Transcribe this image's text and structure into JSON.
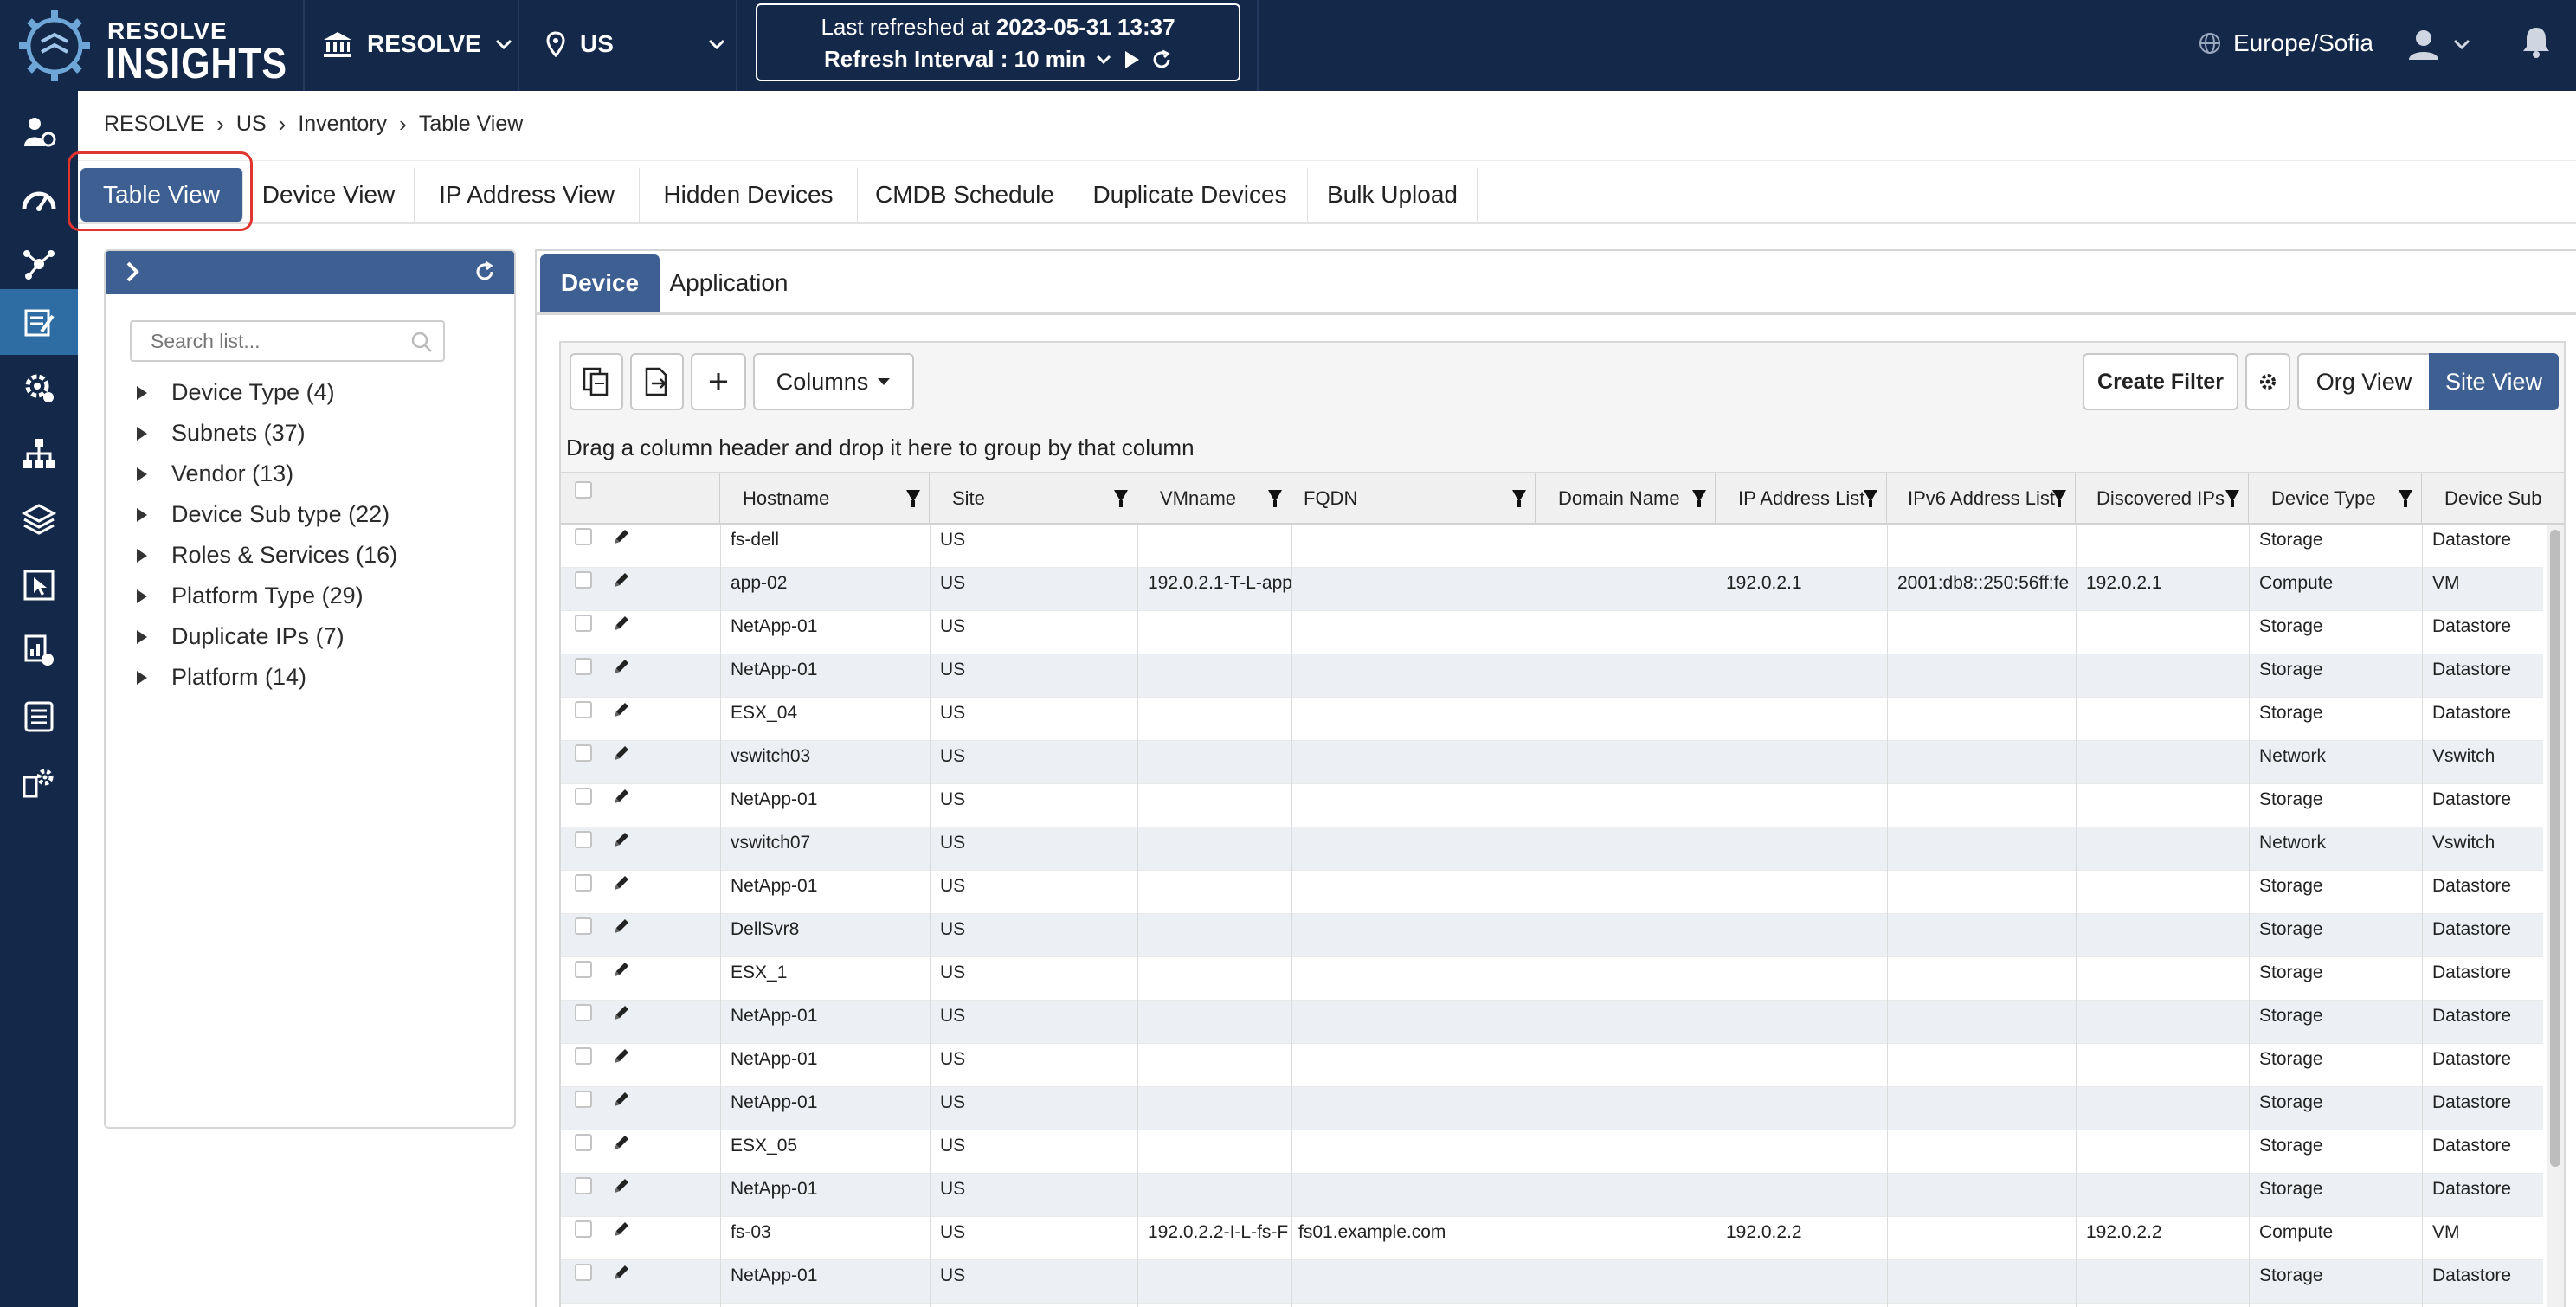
{
  "app": {
    "logo_top": "RESOLVE",
    "logo_bottom": "INSIGHTS",
    "org": "RESOLVE",
    "region": "US",
    "refresh_prefix": "Last refreshed at",
    "refresh_time": "2023-05-31 13:37",
    "refresh_interval": "Refresh Interval : 10 min",
    "timezone": "Europe/Sofia"
  },
  "rail": [
    "operators-icon",
    "dashboard-icon",
    "topology-icon",
    "inventory-icon",
    "automation-icon",
    "network-icon",
    "layers-icon",
    "pointer-icon",
    "reports-icon",
    "list-icon",
    "settings-icon"
  ],
  "breadcrumb": [
    "RESOLVE",
    "US",
    "Inventory",
    "Table View"
  ],
  "tabs": [
    "Table View",
    "Device View",
    "IP Address View",
    "Hidden Devices",
    "CMDB Schedule",
    "Duplicate Devices",
    "Bulk Upload"
  ],
  "tree": {
    "search_placeholder": "Search list...",
    "items": [
      "Device Type (4)",
      "Subnets (37)",
      "Vendor (13)",
      "Device Sub type (22)",
      "Roles & Services (16)",
      "Platform Type (29)",
      "Duplicate IPs (7)",
      "Platform (14)"
    ]
  },
  "subtabs": [
    "Device",
    "Application"
  ],
  "toolbar": {
    "columns_label": "Columns",
    "create_filter": "Create Filter",
    "org_view": "Org View",
    "site_view": "Site View"
  },
  "group_hint": "Drag a column header and drop it here to group by that column",
  "table": {
    "columns": [
      "Hostname",
      "Site",
      "VMname",
      "FQDN",
      "Domain Name",
      "IP Address List",
      "IPv6 Address List",
      "Discovered IPs",
      "Device Type",
      "Device Sub"
    ],
    "rows": [
      [
        "fs-dell",
        "US",
        "",
        "",
        "",
        "",
        "",
        "",
        "Storage",
        "Datastore"
      ],
      [
        "app-02",
        "US",
        "192.0.2.1-T-L-app",
        "",
        "",
        "192.0.2.1",
        "2001:db8::250:56ff:fe",
        "192.0.2.1",
        "Compute",
        "VM"
      ],
      [
        "NetApp-01",
        "US",
        "",
        "",
        "",
        "",
        "",
        "",
        "Storage",
        "Datastore"
      ],
      [
        "NetApp-01",
        "US",
        "",
        "",
        "",
        "",
        "",
        "",
        "Storage",
        "Datastore"
      ],
      [
        "ESX_04",
        "US",
        "",
        "",
        "",
        "",
        "",
        "",
        "Storage",
        "Datastore"
      ],
      [
        "vswitch03",
        "US",
        "",
        "",
        "",
        "",
        "",
        "",
        "Network",
        "Vswitch"
      ],
      [
        "NetApp-01",
        "US",
        "",
        "",
        "",
        "",
        "",
        "",
        "Storage",
        "Datastore"
      ],
      [
        "vswitch07",
        "US",
        "",
        "",
        "",
        "",
        "",
        "",
        "Network",
        "Vswitch"
      ],
      [
        "NetApp-01",
        "US",
        "",
        "",
        "",
        "",
        "",
        "",
        "Storage",
        "Datastore"
      ],
      [
        "DellSvr8",
        "US",
        "",
        "",
        "",
        "",
        "",
        "",
        "Storage",
        "Datastore"
      ],
      [
        "ESX_1",
        "US",
        "",
        "",
        "",
        "",
        "",
        "",
        "Storage",
        "Datastore"
      ],
      [
        "NetApp-01",
        "US",
        "",
        "",
        "",
        "",
        "",
        "",
        "Storage",
        "Datastore"
      ],
      [
        "NetApp-01",
        "US",
        "",
        "",
        "",
        "",
        "",
        "",
        "Storage",
        "Datastore"
      ],
      [
        "NetApp-01",
        "US",
        "",
        "",
        "",
        "",
        "",
        "",
        "Storage",
        "Datastore"
      ],
      [
        "ESX_05",
        "US",
        "",
        "",
        "",
        "",
        "",
        "",
        "Storage",
        "Datastore"
      ],
      [
        "NetApp-01",
        "US",
        "",
        "",
        "",
        "",
        "",
        "",
        "Storage",
        "Datastore"
      ],
      [
        "fs-03",
        "US",
        "192.0.2.2-I-L-fs-F",
        "fs01.example.com",
        "",
        "192.0.2.2",
        "",
        "192.0.2.2",
        "Compute",
        "VM"
      ],
      [
        "NetApp-01",
        "US",
        "",
        "",
        "",
        "",
        "",
        "",
        "Storage",
        "Datastore"
      ]
    ]
  },
  "colors": {
    "navy": "#14294a",
    "accent": "#3d5f91",
    "active_rail": "#2e6da4",
    "highlight": "#e0342e",
    "row_alt": "#ecf0f5"
  }
}
